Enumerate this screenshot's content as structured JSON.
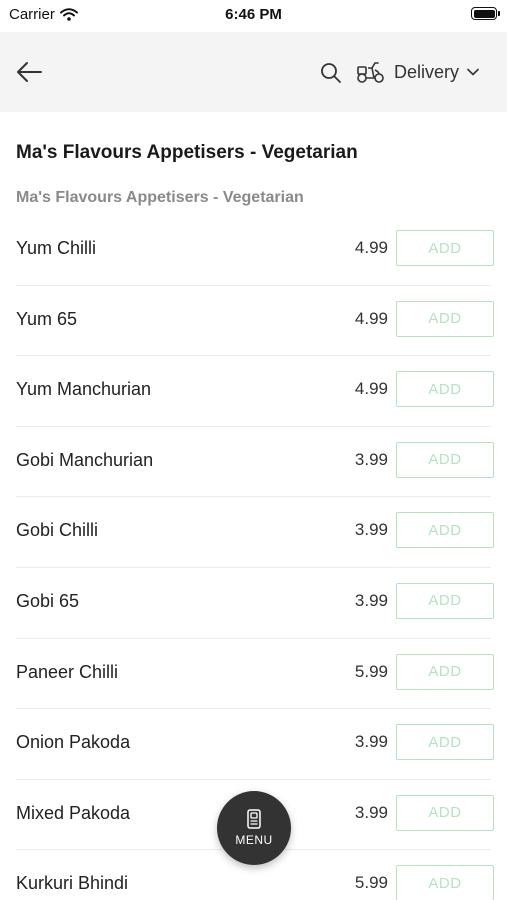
{
  "status_bar": {
    "carrier": "Carrier",
    "time": "6:46 PM"
  },
  "header": {
    "delivery_label": "Delivery"
  },
  "section": {
    "title": "Ma's Flavours Appetisers - Vegetarian",
    "subtitle": "Ma's Flavours Appetisers - Vegetarian"
  },
  "items": [
    {
      "name": "Yum Chilli",
      "price": "4.99",
      "button": "ADD"
    },
    {
      "name": "Yum 65",
      "price": "4.99",
      "button": "ADD"
    },
    {
      "name": "Yum Manchurian",
      "price": "4.99",
      "button": "ADD"
    },
    {
      "name": "Gobi Manchurian",
      "price": "3.99",
      "button": "ADD"
    },
    {
      "name": "Gobi Chilli",
      "price": "3.99",
      "button": "ADD"
    },
    {
      "name": "Gobi 65",
      "price": "3.99",
      "button": "ADD"
    },
    {
      "name": "Paneer Chilli",
      "price": "5.99",
      "button": "ADD"
    },
    {
      "name": "Onion Pakoda",
      "price": "3.99",
      "button": "ADD"
    },
    {
      "name": "Mixed Pakoda",
      "price": "3.99",
      "button": "ADD"
    },
    {
      "name": "Kurkuri Bhindi",
      "price": "5.99",
      "button": "ADD"
    }
  ],
  "menu_fab": {
    "label": "MENU"
  },
  "icons": {
    "back": "back-arrow-icon",
    "search": "search-icon",
    "delivery": "scooter-icon",
    "dropdown": "chevron-down-icon",
    "wifi": "wifi-icon",
    "battery": "battery-icon",
    "menu": "menu-book-icon"
  },
  "colors": {
    "header_bg": "#f4f4f4",
    "add_button": "#b7e2c1",
    "fab_bg": "#333333",
    "subtitle": "#8a8a8a"
  }
}
